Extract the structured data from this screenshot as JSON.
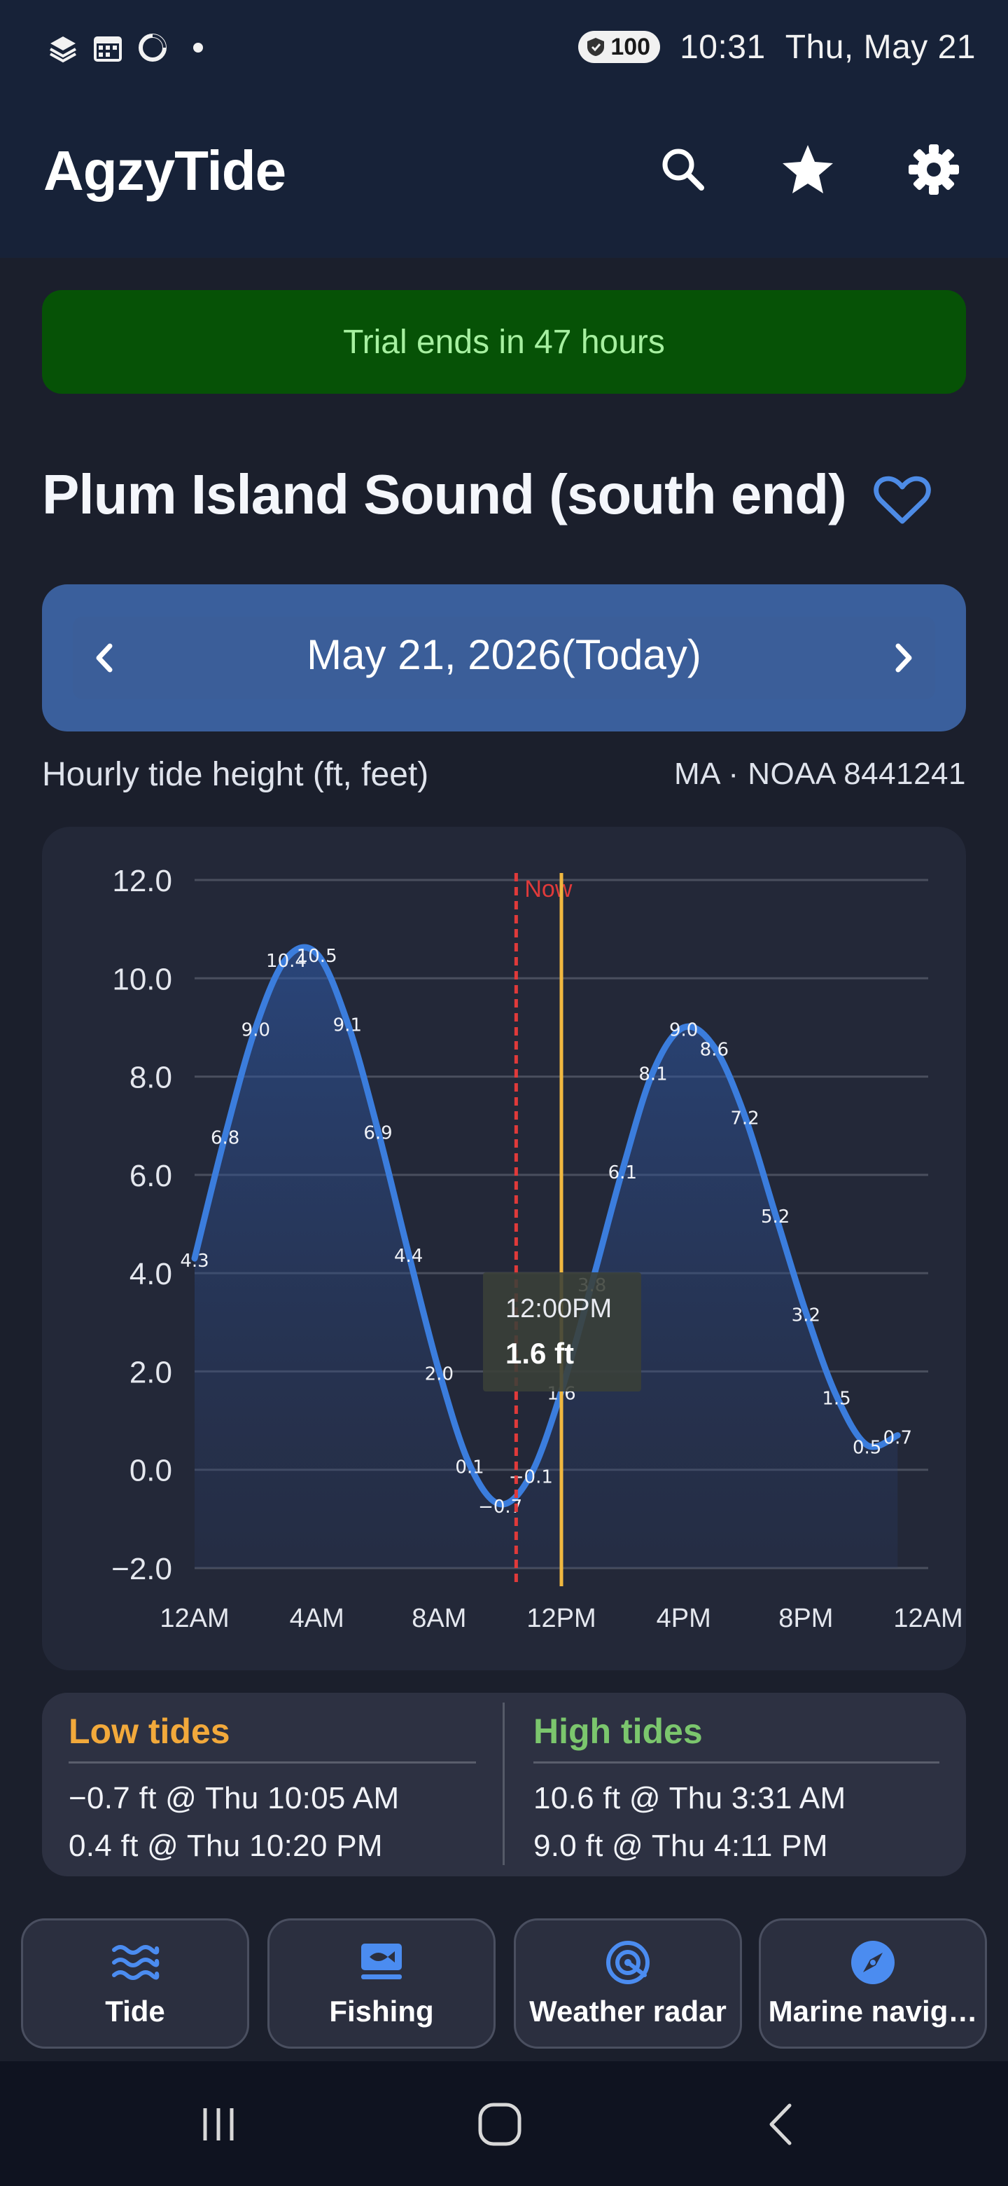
{
  "status_bar": {
    "left_icons": [
      "layers-icon",
      "calendar-icon",
      "sync-icon",
      "notification-dot"
    ],
    "battery": "100",
    "time": "10:31",
    "date": "Thu, May 21"
  },
  "app_bar": {
    "title": "AgzyTide",
    "actions": [
      "search-icon",
      "star-icon",
      "settings-icon"
    ]
  },
  "trial_banner": {
    "text": "Trial ends in 47 hours"
  },
  "station": {
    "title": "Plum Island Sound (south end)",
    "favorite_icon": "heart-outline-icon"
  },
  "date_nav": {
    "label": "May 21, 2026(Today)",
    "prev_icon": "chevron-left-icon",
    "next_icon": "chevron-right-icon"
  },
  "chart_caption": {
    "left": "Hourly tide height (ft, feet)",
    "right": "MA · NOAA 8441241"
  },
  "colors": {
    "accent_blue": "#3b7ddd",
    "low_tide": "#f2a93b",
    "high_tide": "#7bc66d",
    "now_line": "#e03a3a",
    "cursor_line": "#f0b840",
    "trial_green": "#065206"
  },
  "chart_data": {
    "type": "area",
    "ylim": [
      -2,
      12
    ],
    "xlim": [
      0,
      24
    ],
    "y_ticks": [
      "−2.0",
      "0.0",
      "2.0",
      "4.0",
      "6.0",
      "8.0",
      "10.0",
      "12.0"
    ],
    "x_ticks": [
      "12AM",
      "4AM",
      "8AM",
      "12PM",
      "4PM",
      "8PM",
      "12AM"
    ],
    "grid": true,
    "now_label": "Now",
    "now_hour": 10.52,
    "cursor_hour": 12,
    "tooltip": {
      "time": "12:00PM",
      "value": "1.6 ft"
    },
    "series": [
      {
        "x": [
          0,
          1,
          2,
          3,
          4,
          5,
          6,
          7,
          8,
          9,
          10,
          11,
          12,
          13,
          14,
          15,
          16,
          17,
          18,
          19,
          20,
          21,
          22,
          23
        ],
        "values": [
          4.3,
          6.8,
          9.0,
          10.4,
          10.5,
          9.1,
          6.9,
          4.4,
          2.0,
          0.1,
          -0.7,
          -0.1,
          1.6,
          3.8,
          6.1,
          8.1,
          9.0,
          8.6,
          7.2,
          5.2,
          3.2,
          1.5,
          0.5,
          0.7
        ],
        "labels": [
          "4.3",
          "6.8",
          "9.0",
          "10.4",
          "10.5",
          "9.1",
          "6.9",
          "4.4",
          "2.0",
          "0.1",
          "−0.7",
          "−0.1",
          "1.6",
          "3.8",
          "6.1",
          "8.1",
          "9.0",
          "8.6",
          "7.2",
          "5.2",
          "3.2",
          "1.5",
          "0.5",
          "0.7"
        ]
      }
    ]
  },
  "tides": {
    "low": {
      "title": "Low tides",
      "rows": [
        "−0.7 ft @ Thu 10:05 AM",
        "0.4 ft @ Thu 10:20 PM"
      ]
    },
    "high": {
      "title": "High tides",
      "rows": [
        "10.6 ft @ Thu 3:31 AM",
        "9.0 ft @ Thu 4:11 PM"
      ]
    }
  },
  "bottom_tabs": [
    {
      "label": "Tide",
      "icon": "waves-icon"
    },
    {
      "label": "Fishing",
      "icon": "fish-icon"
    },
    {
      "label": "Weather radar",
      "icon": "radar-icon"
    },
    {
      "label": "Marine navig…",
      "icon": "compass-icon"
    }
  ],
  "system_nav": [
    "recents-icon",
    "home-icon",
    "back-icon"
  ]
}
